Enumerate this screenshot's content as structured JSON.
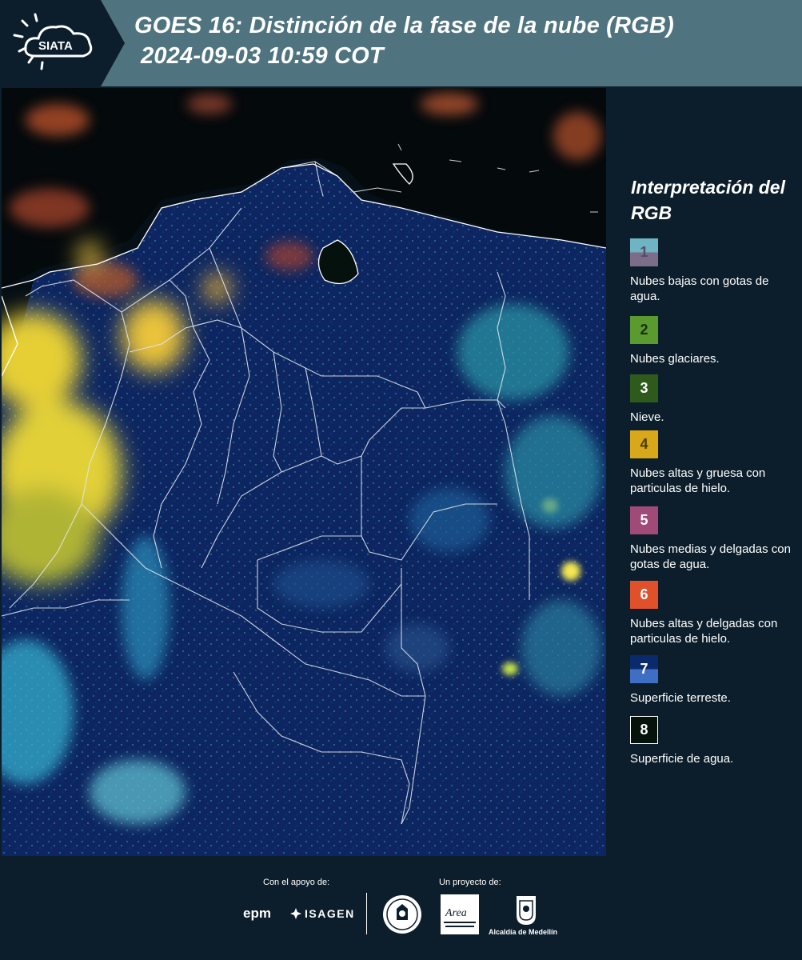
{
  "header": {
    "logo_text": "SIATA",
    "title_line1": "GOES 16: Distinción de la fase de la nube (RGB)",
    "title_line2": "2024-09-03 10:59 COT"
  },
  "legend": {
    "title": "Interpretación del RGB",
    "items": [
      {
        "number": "1",
        "label": "Nubes bajas con gotas de agua.",
        "color_top": "#6fb4c2",
        "color_bottom": "#7c6d8a"
      },
      {
        "number": "2",
        "label": "Nubes glaciares.",
        "color_top": "#5a9a2e",
        "color_bottom": "#5a9a2e"
      },
      {
        "number": "3",
        "label": "Nieve.",
        "color_top": "#2e5b1c",
        "color_bottom": "#2e5b1c"
      },
      {
        "number": "4",
        "label": "Nubes altas y gruesa con particulas de hielo.",
        "color_top": "#d9a81a",
        "color_bottom": "#d9a81a"
      },
      {
        "number": "5",
        "label": "Nubes medias y delgadas con gotas de agua.",
        "color_top": "#a04a77",
        "color_bottom": "#a04a77"
      },
      {
        "number": "6",
        "label": "Nubes altas y delgadas con particulas de hielo.",
        "color_top": "#e0502b",
        "color_bottom": "#e0502b"
      },
      {
        "number": "7",
        "label": "Superficie terreste.",
        "color_top": "#0b2a6b",
        "color_bottom": "#3f6fc4"
      },
      {
        "number": "8",
        "label": "Superficie de agua.",
        "color_top": "#05130a",
        "color_bottom": "#05130a"
      }
    ]
  },
  "footer": {
    "support_label": "Con el apoyo de:",
    "project_label": "Un proyecto de:",
    "sponsor1": "epm",
    "sponsor2": "ISAGEN",
    "partner_label": "Alcaldía de Medellín",
    "area_logo_word": "Area"
  },
  "colors": {
    "header_bg": "#4f7480",
    "page_bg": "#0c1e2b",
    "land": "#0e2a66",
    "sea": "#050d12"
  }
}
